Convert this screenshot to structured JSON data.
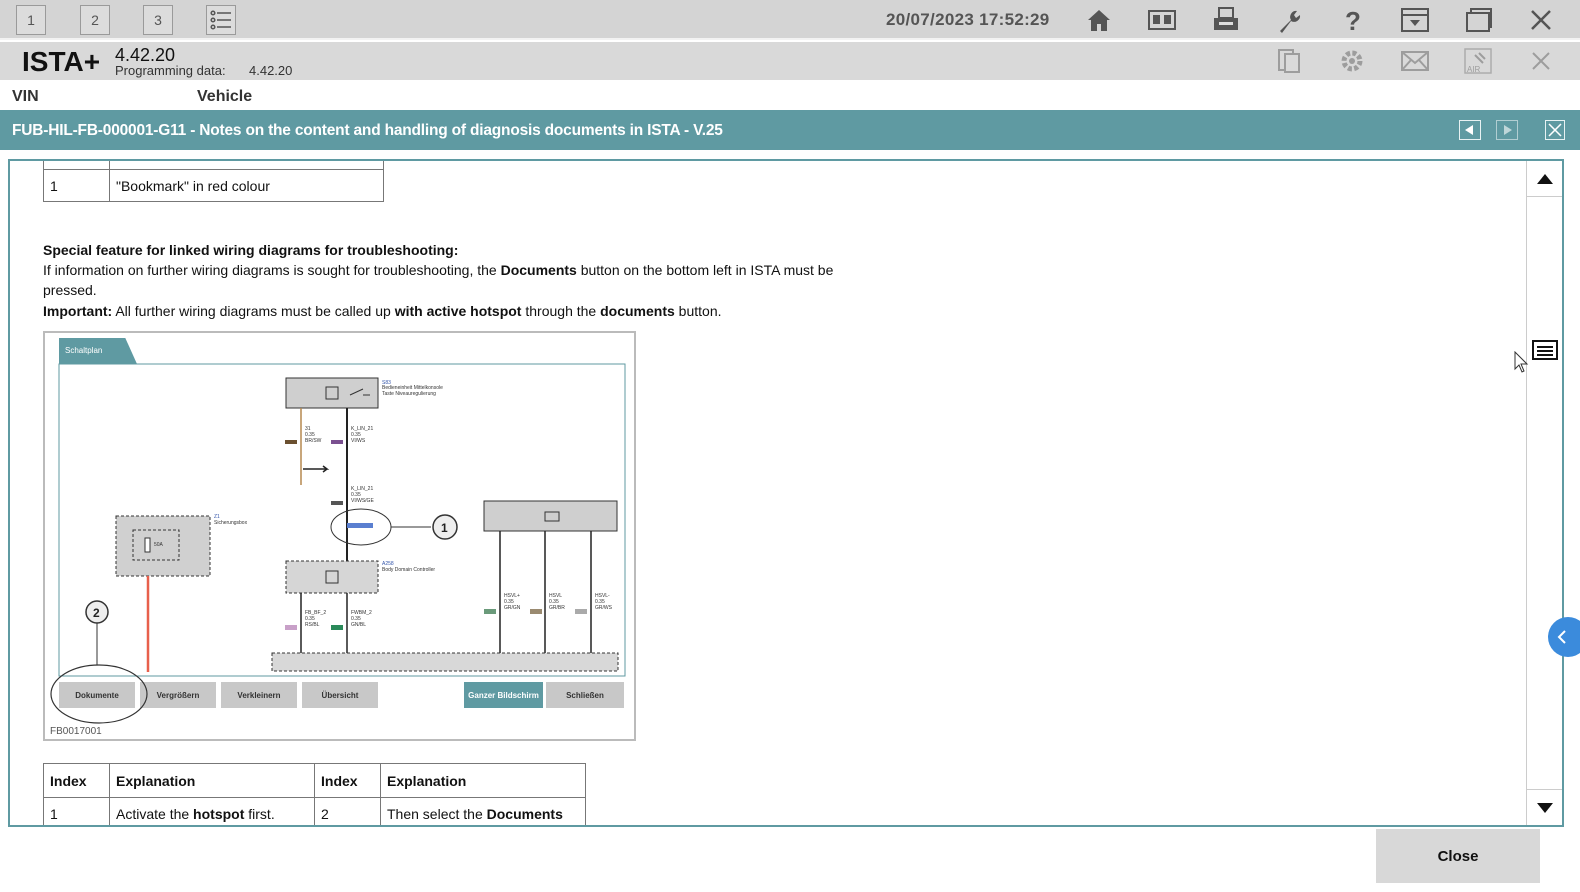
{
  "topbar": {
    "tabs": [
      "1",
      "2",
      "3"
    ],
    "datetime": "20/07/2023 17:52:29",
    "icons": [
      "list-icon",
      "home-icon",
      "vehicle-info-icon",
      "print-icon",
      "wrench-icon",
      "help-icon",
      "dropdown-window-icon",
      "restore-window-icon",
      "close-icon"
    ]
  },
  "appbar": {
    "name": "ISTA+",
    "version": "4.42.20",
    "programming_label": "Programming data:",
    "programming_value": "4.42.20",
    "icons": [
      "document-icon",
      "gear-icon",
      "mail-icon",
      "air-icon",
      "close-icon"
    ]
  },
  "vinbar": {
    "vin_label": "VIN",
    "vehicle_label": "Vehicle"
  },
  "document": {
    "title": "FUB-HIL-FB-000001-G11 - Notes on the content and handling of diagnosis documents in ISTA - V.25",
    "top_table_row": {
      "index": "1",
      "text": "\"Bookmark\" in red colour"
    },
    "heading": "Special feature for linked wiring diagrams for troubleshooting:",
    "para1_a": "If information on further wiring diagrams is sought for troubleshooting, the ",
    "para1_b": "Documents",
    "para1_c": " button on the bottom left in ISTA must be",
    "para1_d": "pressed.",
    "para2_a": "Important:",
    "para2_b": " All further wiring diagrams must be called up ",
    "para2_c": "with active hotspot",
    "para2_d": " through the ",
    "para2_e": "documents",
    "para2_f": " button.",
    "figure": {
      "tab_label": "Schaltplan",
      "caption": "FB0017001",
      "callout_1": "1",
      "callout_2": "2",
      "buttons": [
        "Dokumente",
        "Vergrößern",
        "Verkleinern",
        "Übersicht",
        "Ganzer Bildschirm",
        "Schließen"
      ],
      "labels": {
        "s83": "S83",
        "s83_desc1": "Bedieneinheit Mittelkonsole",
        "s83_desc2": "Taste Niveauregulierung",
        "a258": "A258",
        "a258_desc": "Body Domain Controller",
        "z1": "Z1",
        "z1_desc": "Sicherungsbox",
        "fuse": "50A",
        "w31": "31",
        "w31_size": "0.35",
        "w31_color": "BR/SW",
        "klin1": "K_LIN_21",
        "klin1_size": "0.35",
        "klin1_color": "VI/WS",
        "klin2": "K_LIN_21",
        "klin2_size": "0.35",
        "klin2_color": "VI/WS/GE",
        "fbbf": "FB_BF_2",
        "fbbf_size": "0.35",
        "fbbf_color": "RS/BL",
        "fwbm": "FWBM_2",
        "fwbm_size": "0.35",
        "fwbm_color": "GN/BL",
        "hsvl1": "HSVL+",
        "hsvl1_size": "0.35",
        "hsvl1_color": "GR/GN",
        "hsvl2": "HSVL",
        "hsvl2_size": "0.35",
        "hsvl2_color": "GR/BR",
        "hsvl3": "HSVL-",
        "hsvl3_size": "0.35",
        "hsvl3_color": "GR/WS"
      }
    },
    "bottom_table": {
      "headers": [
        "Index",
        "Explanation",
        "Index",
        "Explanation"
      ],
      "row": {
        "idx1": "1",
        "exp1_a": "Activate the ",
        "exp1_b": "hotspot",
        "exp1_c": " first.",
        "idx2": "2",
        "exp2_a": "Then select the ",
        "exp2_b": "Documents"
      }
    }
  },
  "footer": {
    "close_label": "Close"
  },
  "colors": {
    "accent": "#5f9aa2",
    "toolbar_bg": "#d4d4d4",
    "red_wire": "#e8604c"
  }
}
